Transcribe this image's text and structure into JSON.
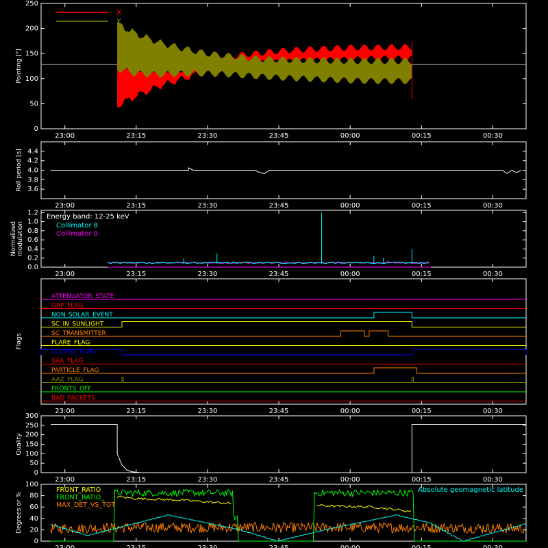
{
  "chart_data": [
    {
      "id": "pointing",
      "type": "line",
      "ylabel": "Pointing [\"]",
      "ylim": [
        0,
        250
      ],
      "yticks": [
        0,
        50,
        100,
        150,
        200,
        250
      ],
      "xlim": [
        "22:55",
        "00:37"
      ],
      "xtick_labels": [
        "23:00",
        "23:15",
        "23:30",
        "23:45",
        "00:00",
        "00:15",
        "00:30"
      ],
      "baseline": 128,
      "legend": [
        {
          "label": "X",
          "color": "#ff0000"
        },
        {
          "label": "Y",
          "color": "#808000"
        }
      ],
      "series": [
        {
          "name": "X",
          "color": "#ff0000",
          "x": [
            "23:11",
            "23:15",
            "23:20",
            "23:25",
            "23:30",
            "23:35",
            "23:40",
            "23:45",
            "23:50",
            "23:55",
            "00:00",
            "00:05",
            "00:10",
            "00:13"
          ],
          "low": [
            45,
            65,
            85,
            100,
            115,
            125,
            130,
            133,
            135,
            137,
            138,
            140,
            140,
            140
          ],
          "high": [
            130,
            120,
            118,
            118,
            130,
            145,
            150,
            155,
            158,
            160,
            162,
            162,
            163,
            163
          ]
        },
        {
          "name": "Y",
          "color": "#808000",
          "x": [
            "23:11",
            "23:15",
            "23:20",
            "23:25",
            "23:30",
            "23:35",
            "23:40",
            "23:45",
            "23:50",
            "23:55",
            "00:00",
            "00:05",
            "00:10",
            "00:13"
          ],
          "low": [
            120,
            110,
            108,
            110,
            110,
            108,
            105,
            102,
            100,
            98,
            96,
            95,
            95,
            95
          ],
          "high": [
            210,
            190,
            172,
            160,
            150,
            145,
            140,
            138,
            137,
            136,
            135,
            135,
            135,
            135
          ]
        }
      ]
    },
    {
      "id": "roll",
      "type": "line",
      "ylabel": "Roll period [s]",
      "ylim": [
        3.4,
        4.6
      ],
      "yticks": [
        3.6,
        3.8,
        4.0,
        4.2,
        4.4
      ],
      "xtick_labels": [
        "23:00",
        "23:15",
        "23:30",
        "23:45",
        "00:00",
        "00:15",
        "00:30"
      ],
      "series": [
        {
          "name": "",
          "color": "#ffffff",
          "x": [
            "22:57",
            "23:26",
            "23:26",
            "23:27",
            "23:40",
            "23:41",
            "23:42",
            "23:43",
            "00:32",
            "00:33",
            "00:34",
            "00:35",
            "00:36"
          ],
          "y": [
            4.0,
            4.0,
            4.05,
            4.0,
            4.0,
            3.95,
            3.93,
            4.0,
            4.0,
            3.93,
            4.0,
            3.95,
            4.0
          ]
        }
      ]
    },
    {
      "id": "modulation",
      "type": "line",
      "ylabel": "Normalized modulation",
      "ylim": [
        0,
        1.25
      ],
      "yticks": [
        0.0,
        0.2,
        0.4,
        0.6,
        0.8,
        1.0,
        1.2
      ],
      "xtick_labels": [
        "23:00",
        "23:15",
        "23:30",
        "23:45",
        "00:00",
        "00:15",
        "00:30"
      ],
      "annotation": "Energy band: 12-25 keV",
      "legend": [
        {
          "label": "Collimator 8",
          "color": "#00ffff"
        },
        {
          "label": "Collimator 9",
          "color": "#ff00ff"
        }
      ],
      "series": [
        {
          "name": "Collimator 8",
          "color": "#00ffff",
          "x": [
            "23:09",
            "23:25",
            "23:32",
            "23:42",
            "23:54",
            "00:05",
            "00:07",
            "00:13",
            "00:17"
          ],
          "y": [
            0.09,
            0.2,
            0.3,
            0.1,
            1.2,
            0.25,
            0.2,
            0.4,
            0.1
          ]
        },
        {
          "name": "Collimator 9",
          "color": "#ff00ff",
          "x": [
            "23:09",
            "23:30",
            "23:50",
            "00:05",
            "00:08",
            "00:17"
          ],
          "y": [
            0.07,
            0.08,
            0.08,
            0.1,
            0.15,
            0.07
          ]
        }
      ]
    },
    {
      "id": "flags",
      "type": "line",
      "ylabel": "Flags",
      "xtick_labels": [
        "23:00",
        "23:15",
        "23:30",
        "23:45",
        "00:00",
        "00:15",
        "00:30"
      ],
      "flags": [
        {
          "label": "ATTENUATOR_STATE",
          "color": "#ff00ff",
          "on": []
        },
        {
          "label": "GAP_FLAG",
          "color": "#ff0000",
          "on": []
        },
        {
          "label": "NON_SOLAR_EVENT",
          "color": "#00ffff",
          "on": [
            [
              "00:05",
              "00:13"
            ]
          ]
        },
        {
          "label": "SC_IN_SUNLIGHT",
          "color": "#ffff00",
          "on": [
            [
              "23:12",
              "00:13"
            ]
          ]
        },
        {
          "label": "SC_TRANSMITTER",
          "color": "#ff8000",
          "on": [
            [
              "23:58",
              "00:03"
            ],
            [
              "00:04",
              "00:08"
            ]
          ]
        },
        {
          "label": "FLARE_FLAG",
          "color": "#ffff00",
          "on": []
        },
        {
          "label": "ECLIPSE_FLAG",
          "color": "#0000ff",
          "on": [
            [
              "22:55",
              "23:12"
            ],
            [
              "00:13",
              "00:37"
            ]
          ]
        },
        {
          "label": "SAA_FLAG",
          "color": "#ff0000",
          "on": []
        },
        {
          "label": "PARTICLE_FLAG",
          "color": "#ff8000",
          "on": [
            [
              "00:05",
              "00:14"
            ]
          ]
        },
        {
          "label": "AAZ_FLAG",
          "color": "#808000",
          "on": [
            [
              "23:12",
              "23:12"
            ],
            [
              "00:13",
              "00:13"
            ]
          ]
        },
        {
          "label": "FRONTS_OFF",
          "color": "#00ff00",
          "on": []
        },
        {
          "label": "BAD_PACKETS",
          "color": "#ff0000",
          "on": []
        }
      ]
    },
    {
      "id": "quality",
      "type": "line",
      "ylabel": "Quality",
      "ylim": [
        0,
        300
      ],
      "yticks": [
        0,
        50,
        100,
        150,
        200,
        250,
        300
      ],
      "xtick_labels": [
        "23:00",
        "23:15",
        "23:30",
        "23:45",
        "00:00",
        "00:15",
        "00:30"
      ],
      "series": [
        {
          "name": "",
          "color": "#ffffff",
          "x": [
            "22:57",
            "23:11",
            "23:11",
            "23:12",
            "23:13",
            "23:14",
            "23:15",
            "23:16",
            "00:13",
            "00:13",
            "00:37"
          ],
          "y": [
            255,
            255,
            100,
            40,
            15,
            5,
            2,
            0,
            0,
            255,
            255
          ]
        }
      ]
    },
    {
      "id": "ratios",
      "type": "line",
      "ylabel": "Degrees or %",
      "ylim": [
        0,
        100
      ],
      "yticks": [
        0,
        20,
        40,
        60,
        80,
        100
      ],
      "xtick_labels": [
        "23:00",
        "23:15",
        "23:30",
        "23:45",
        "00:00",
        "00:15",
        "00:30"
      ],
      "legend": [
        {
          "label": "FRONT_RATIO",
          "color": "#ffff00"
        },
        {
          "label": "FRONT_RATIO_",
          "color": "#00ff00"
        },
        {
          "label": "MAX_DET_VS_TOT",
          "color": "#ff8000"
        },
        {
          "label": "Absolute geomagnetic latitude",
          "color": "#00ffff"
        }
      ],
      "series": [
        {
          "name": "FRONT_RATIO",
          "color": "#ffff00",
          "x": [
            "23:11",
            "23:15",
            "23:25",
            "23:35",
            "23:38",
            "23:52",
            "23:55",
            "00:05",
            "00:10",
            "00:13"
          ],
          "y": [
            78,
            75,
            72,
            66,
            63,
            64,
            62,
            60,
            55,
            52
          ]
        },
        {
          "name": "FRONT_RATIO_",
          "color": "#00ff00",
          "x": [
            "22:57",
            "23:10",
            "23:11",
            "23:35",
            "23:37",
            "23:52",
            "23:53",
            "00:13",
            "00:14",
            "00:37"
          ],
          "y": [
            0,
            0,
            85,
            85,
            0,
            0,
            85,
            85,
            0,
            0
          ]
        },
        {
          "name": "MAX_DET_VS_TOT",
          "color": "#ff8000",
          "x": [
            "22:57",
            "23:15",
            "23:30",
            "23:45",
            "00:00",
            "00:15",
            "00:37"
          ],
          "y": [
            22,
            24,
            24,
            24,
            24,
            24,
            22
          ]
        },
        {
          "name": "Absolute geomagnetic latitude",
          "color": "#00ffff",
          "x": [
            "22:57",
            "23:05",
            "23:22",
            "23:37",
            "23:45",
            "23:55",
            "00:10",
            "00:17",
            "00:24",
            "00:37"
          ],
          "y": [
            30,
            10,
            46,
            20,
            0,
            20,
            46,
            32,
            0,
            30
          ]
        }
      ]
    }
  ]
}
